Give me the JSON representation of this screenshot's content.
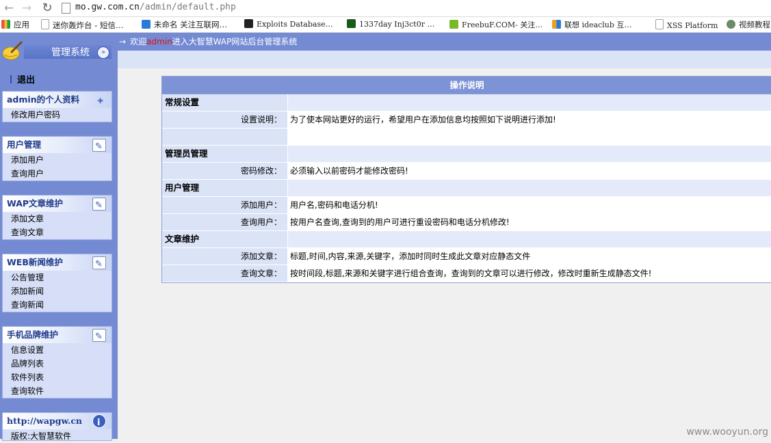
{
  "browser": {
    "url_host": "mo.gw.com.cn",
    "url_path": "/admin/default.php",
    "bookmarks": [
      {
        "label": "应用",
        "icon": "apps-grid-icon",
        "color": "#e8534a"
      },
      {
        "label": "迷你轰炸台 - 短信…",
        "icon": "page-icon",
        "color": "#9aa0a6"
      },
      {
        "label": "未命名 关注互联网…",
        "icon": "mb-icon",
        "color": "#2a7ad8"
      },
      {
        "label": "Exploits Database…",
        "icon": "exploit-db-icon",
        "color": "#222222"
      },
      {
        "label": "1337day Inj3ct0r …",
        "icon": "1337day-icon",
        "color": "#2a8a2a"
      },
      {
        "label": "FreebuF.COM- 关注…",
        "icon": "freebuf-icon",
        "color": "#7ab82a"
      },
      {
        "label": "联想 ideaclub 互…",
        "icon": "lenovo-icon",
        "color": "#e8a020"
      },
      {
        "label": "XSS Platform",
        "icon": "page-icon",
        "color": "#9aa0a6"
      },
      {
        "label": "视频教程",
        "icon": "avatar-icon",
        "color": "#6a8a6a"
      }
    ]
  },
  "sidebar": {
    "title": "管理系统",
    "logout": "退出",
    "boxes": [
      {
        "title": "admin的个人资料",
        "items": [
          "修改用户密码"
        ]
      },
      {
        "title": "用户管理",
        "items": [
          "添加用户",
          "查询用户"
        ]
      },
      {
        "title": "WAP文章维护",
        "items": [
          "添加文章",
          "查询文章"
        ]
      },
      {
        "title": "WEB新闻维护",
        "items": [
          "公告管理",
          "添加新闻",
          "查询新闻"
        ]
      },
      {
        "title": "手机品牌维护",
        "items": [
          "信息设置",
          "品牌列表",
          "软件列表",
          "查询软件"
        ]
      },
      {
        "title": "http://wapgw.cn",
        "items": [
          "版权:大智慧软件"
        ]
      }
    ]
  },
  "main": {
    "welcome_arrow": "→",
    "welcome_prefix": "欢迎",
    "welcome_user": "admin",
    "welcome_suffix": "进入大智慧WAP网站后台管理系统",
    "table": {
      "title": "操作说明",
      "rows": [
        {
          "type": "section",
          "label": "常规设置",
          "value": ""
        },
        {
          "type": "item",
          "label": "设置说明：",
          "value": "为了使本网站更好的运行，希望用户在添加信息均按照如下说明进行添加!"
        },
        {
          "type": "item",
          "label": "",
          "value": ""
        },
        {
          "type": "section",
          "label": "管理员管理",
          "value": ""
        },
        {
          "type": "item",
          "label": "密码修改：",
          "value": " 必须输入以前密码才能修改密码!"
        },
        {
          "type": "section",
          "label": "用户管理",
          "value": ""
        },
        {
          "type": "item",
          "label": "添加用户：",
          "value": "用户名,密码和电话分机!"
        },
        {
          "type": "item",
          "label": "查询用户：",
          "value": "按用户名查询,查询到的用户可进行重设密码和电话分机修改!"
        },
        {
          "type": "section",
          "label": "文章维护",
          "value": ""
        },
        {
          "type": "item",
          "label": "添加文章：",
          "value": "标题,时间,内容,来源,关键字，添加时同时生成此文章对应静态文件"
        },
        {
          "type": "item",
          "label": "查询文章：",
          "value": "按时间段,标题,来源和关键字进行组合查询，查询到的文章可以进行修改，修改时重新生成静态文件!"
        }
      ]
    }
  },
  "watermark": "www.wooyun.org"
}
